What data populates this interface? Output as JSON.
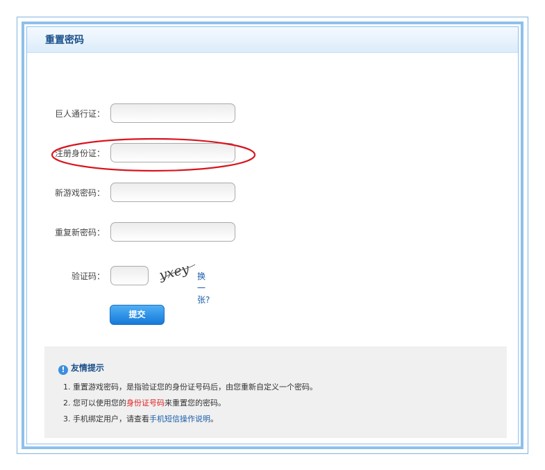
{
  "header": {
    "title": "重置密码"
  },
  "form": {
    "account_label": "巨人通行证：",
    "id_label": "注册身份证：",
    "new_password_label": "新游戏密码：",
    "repeat_password_label": "重复新密码：",
    "captcha_label": "验证码：",
    "captcha_text": "yxey",
    "change_captcha": "换一张?",
    "submit": "提交",
    "account_value": "",
    "id_value": "",
    "new_password_value": "",
    "repeat_password_value": "",
    "captcha_value": ""
  },
  "tips": {
    "title": "友情提示",
    "icon": "info-icon",
    "line1": "1. 重置游戏密码，是指验证您的身份证号码后，由您重新自定义一个密码。",
    "line2_prefix": "2. 您可以使用您的",
    "line2_highlight": "身份证号码",
    "line2_suffix": "来重置您的密码。",
    "line3_prefix": "3. 手机绑定用户，请查看",
    "line3_link": "手机短信操作说明",
    "line3_suffix": "。"
  },
  "colors": {
    "frame": "#8ec0ec",
    "title": "#1a4f8a",
    "link": "#1a5da8",
    "highlight_red": "#e02020",
    "ellipse": "#d9141e",
    "button": "#1679d8"
  }
}
